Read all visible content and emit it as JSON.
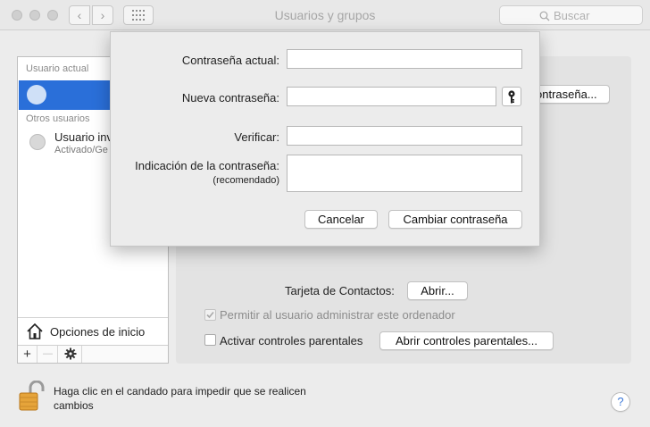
{
  "window": {
    "title": "Usuarios y grupos"
  },
  "toolbar": {
    "back": "‹",
    "forward": "›",
    "search_placeholder": "Buscar"
  },
  "sidebar": {
    "current_header": "Usuario actual",
    "others_header": "Otros usuarios",
    "other_user": {
      "name": "Usuario inv",
      "role": "Activado/Ge"
    },
    "login_options": "Opciones de inicio",
    "add": "+",
    "remove": "—"
  },
  "main": {
    "change_password_button": "ontraseña...",
    "contacts_label": "Tarjeta de Contactos:",
    "contacts_button": "Abrir...",
    "admin_checkbox_label": "Permitir al usuario administrar este ordenador",
    "admin_checked": true,
    "parental_checkbox_label": "Activar controles parentales",
    "parental_checked": false,
    "parental_button": "Abrir controles parentales..."
  },
  "lock": {
    "text": "Haga clic en el candado para impedir que se realicen cambios"
  },
  "help": "?",
  "sheet": {
    "current_label": "Contraseña actual:",
    "new_label": "Nueva contraseña:",
    "verify_label": "Verificar:",
    "hint_label": "Indicación de la contraseña:",
    "hint_note": "(recomendado)",
    "current_value": "",
    "new_value": "",
    "verify_value": "",
    "hint_value": "",
    "cancel": "Cancelar",
    "submit": "Cambiar contraseña"
  },
  "colors": {
    "selection": "#2a6fd9",
    "help": "#3b77d8"
  }
}
